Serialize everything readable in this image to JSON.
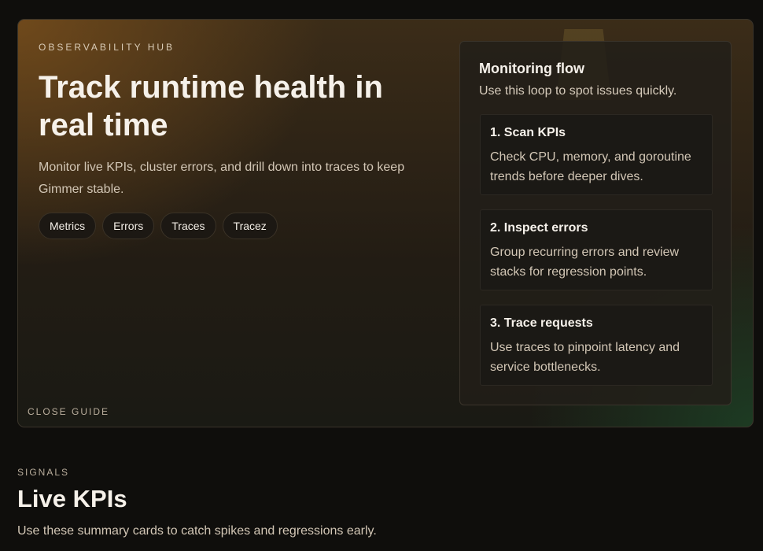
{
  "hero": {
    "eyebrow": "OBSERVABILITY HUB",
    "title": "Track runtime health in real time",
    "description": "Monitor live KPIs, cluster errors, and drill down into traces to keep Gimmer stable.",
    "chips": [
      "Metrics",
      "Errors",
      "Traces",
      "Tracez"
    ],
    "close_label": "CLOSE GUIDE"
  },
  "flow": {
    "title": "Monitoring flow",
    "subtitle": "Use this loop to spot issues quickly.",
    "steps": [
      {
        "title": "1. Scan KPIs",
        "description": "Check CPU, memory, and goroutine trends before deeper dives."
      },
      {
        "title": "2. Inspect errors",
        "description": "Group recurring errors and review stacks for regression points."
      },
      {
        "title": "3. Trace requests",
        "description": "Use traces to pinpoint latency and service bottlenecks."
      }
    ]
  },
  "signals": {
    "eyebrow": "SIGNALS",
    "title": "Live KPIs",
    "description": "Use these summary cards to catch spikes and regressions early."
  }
}
